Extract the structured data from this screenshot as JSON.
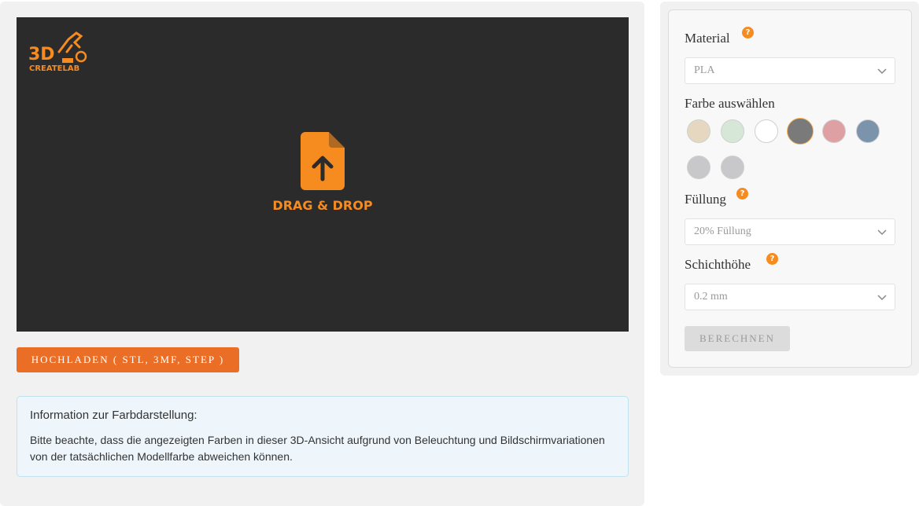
{
  "viewer": {
    "logo_text_top": "3D",
    "logo_text_bottom": "CREATELAB",
    "drop_label": "DRAG & DROP",
    "drop_icon": "file-upload-icon"
  },
  "upload": {
    "label": "HOCHLADEN ( STL, 3MF, STEP )"
  },
  "info": {
    "title": "Information zur Farbdarstellung:",
    "text": "Bitte beachte, dass die angezeigten Farben in dieser 3D-Ansicht aufgrund von Beleuchtung und Bildschirmvariationen von der tatsächlichen Modellfarbe abweichen können."
  },
  "config": {
    "material": {
      "label": "Material",
      "help": "?",
      "value": "PLA"
    },
    "color": {
      "label": "Farbe auswählen",
      "swatches": [
        "#b3a39a",
        "#e6d8c0",
        "#d6e7d8",
        "#ffffff",
        "#7a7a7a",
        "#dea0a3",
        "#7b93ab",
        "#c8c8ca"
      ],
      "selected_index": 3
    },
    "infill": {
      "label": "Füllung",
      "help": "?",
      "value": "20% Füllung"
    },
    "layer": {
      "label": "Schichthöhe",
      "help": "?",
      "value": "0.2 mm"
    },
    "calculate_label": "BERECHNEN"
  },
  "colors": {
    "accent": "#f68b1f",
    "upload_button": "#eb6e26",
    "viewer_bg": "#2b2b2b"
  }
}
